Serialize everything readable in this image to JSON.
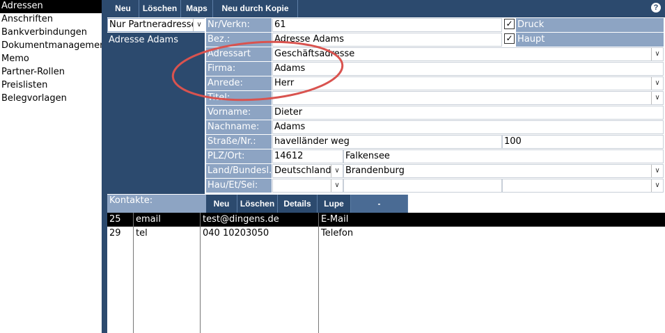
{
  "nav": {
    "items": [
      "Adressen",
      "Anschriften",
      "Bankverbindungen",
      "Dokumentmanagement",
      "Memo",
      "Partner-Rollen",
      "Preislisten",
      "Belegvorlagen"
    ],
    "selected_index": 0
  },
  "toolbar": {
    "neu": "Neu",
    "loeschen": "Löschen",
    "maps": "Maps",
    "neu_kopie": "Neu durch Kopie",
    "help": "?"
  },
  "filter": {
    "value": "Nur Partneradresse",
    "list": [
      "Adresse Adams"
    ]
  },
  "form": {
    "nr_label": "Nr/Verkn:",
    "nr_value": "61",
    "druck_label": "Druck",
    "druck_checked": true,
    "bez_label": "Bez.:",
    "bez_value": "Adresse Adams",
    "haupt_label": "Haupt",
    "haupt_checked": true,
    "adressart_label": "Adressart",
    "adressart_value": "Geschäftsadresse",
    "firma_label": "Firma:",
    "firma_value": "Adams",
    "anrede_label": "Anrede:",
    "anrede_value": "Herr",
    "titel_label": "Titel:",
    "titel_value": "",
    "vorname_label": "Vorname:",
    "vorname_value": "Dieter",
    "nachname_label": "Nachname:",
    "nachname_value": "Adams",
    "strasse_label": "Straße/Nr.:",
    "strasse_value": "havelländer weg",
    "hausnr_value": "100",
    "plz_label": "PLZ/Ort:",
    "plz_value": "14612",
    "ort_value": "Falkensee",
    "land_label": "Land/Bundesl.",
    "land_value": "Deutschland",
    "bundesland_value": "Brandenburg",
    "hau_label": "Hau/Et/Sei:",
    "hau_value": "",
    "et_value": "",
    "sei_value": ""
  },
  "contacts": {
    "label": "Kontakte:",
    "buttons": {
      "neu": "Neu",
      "loeschen": "Löschen",
      "details": "Details",
      "lupe": "Lupe",
      "dash": "-"
    },
    "rows": [
      {
        "id": "25",
        "type": "email",
        "value": "test@dingens.de",
        "desc": "E-Mail",
        "selected": true
      },
      {
        "id": "29",
        "type": "tel",
        "value": "040 10203050",
        "desc": "Telefon",
        "selected": false
      }
    ]
  },
  "colors": {
    "accent_dark": "#2c4a6e",
    "label_bg": "#8da4c3",
    "panel_bg": "#dfe6ef",
    "highlight_circle": "#d9534f"
  }
}
